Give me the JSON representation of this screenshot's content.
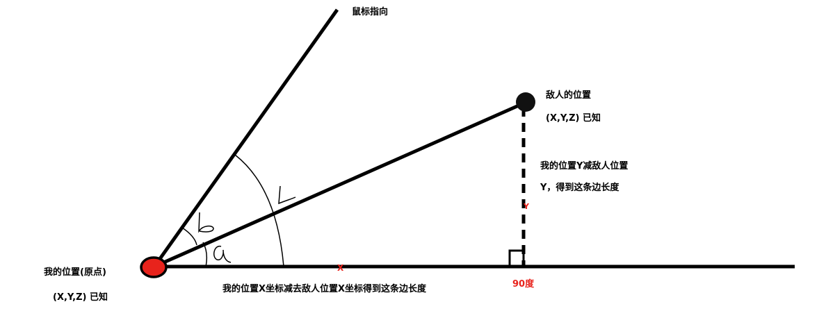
{
  "labels": {
    "mouse_direction": "鼠标指向",
    "enemy_position": "敌人的位置",
    "enemy_known": "(X,Y,Z) 已知",
    "y_note_line1": "我的位置Y减敌人位置",
    "y_note_line2": "Y，得到这条边长度",
    "y_marker": "Y",
    "x_marker": "X",
    "my_position": "我的位置(原点)",
    "my_known": "(X,Y,Z) 已知",
    "x_note": "我的位置X坐标减去敌人位置X坐标得到这条边长度",
    "right_angle": "90度"
  },
  "colors": {
    "ink": "#000000",
    "origin_fill": "#e8231c",
    "enemy_fill": "#111111",
    "marker_red": "#e8231c"
  }
}
